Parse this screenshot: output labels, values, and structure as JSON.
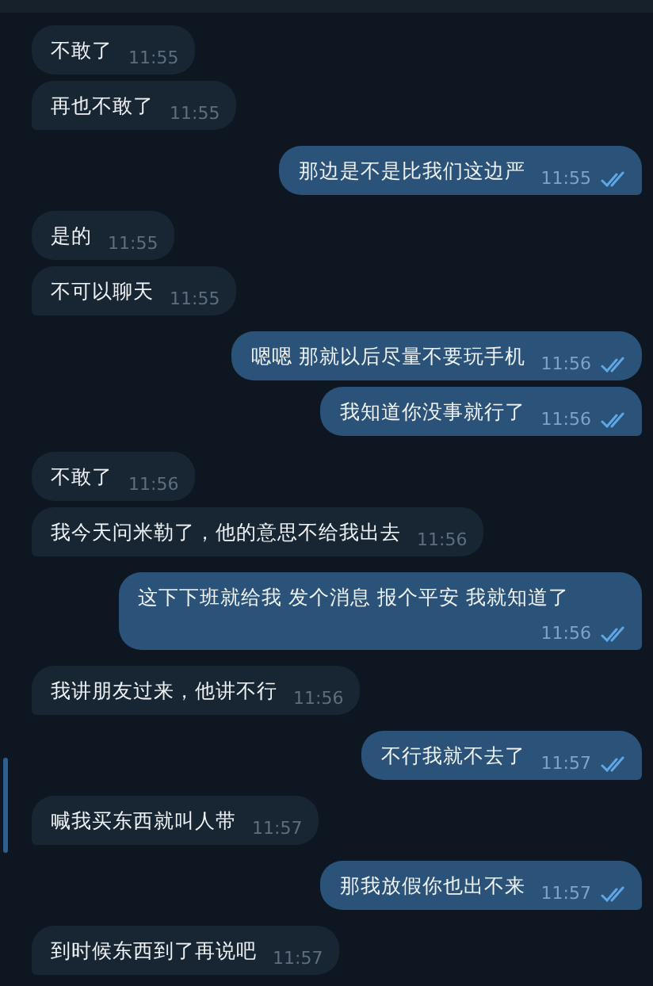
{
  "messages": [
    {
      "kind": "received",
      "text": "不敢了",
      "time": "11:55"
    },
    {
      "kind": "received",
      "text": "再也不敢了",
      "time": "11:55"
    },
    {
      "kind": "sent",
      "text": "那边是不是比我们这边严",
      "time": "11:55",
      "read": true
    },
    {
      "kind": "received",
      "text": "是的",
      "time": "11:55"
    },
    {
      "kind": "received",
      "text": "不可以聊天",
      "time": "11:55"
    },
    {
      "kind": "sent",
      "text": "嗯嗯  那就以后尽量不要玩手机",
      "time": "11:56",
      "read": true
    },
    {
      "kind": "sent",
      "text": "我知道你没事就行了",
      "time": "11:56",
      "read": true
    },
    {
      "kind": "received",
      "text": "不敢了",
      "time": "11:56"
    },
    {
      "kind": "received",
      "text": "我今天问米勒了，他的意思不给我出去",
      "time": "11:56"
    },
    {
      "kind": "sent",
      "text": "这下下班就给我 发个消息 报个平安 我就知道了",
      "time": "11:56",
      "read": true
    },
    {
      "kind": "received",
      "text": "我讲朋友过来，他讲不行",
      "time": "11:56"
    },
    {
      "kind": "sent",
      "text": "不行我就不去了",
      "time": "11:57",
      "read": true
    },
    {
      "kind": "received",
      "text": "喊我买东西就叫人带",
      "time": "11:57"
    },
    {
      "kind": "sent",
      "text": "那我放假你也出不来",
      "time": "11:57",
      "read": true
    },
    {
      "kind": "received",
      "text": "到时候东西到了再说吧",
      "time": "11:57"
    }
  ]
}
